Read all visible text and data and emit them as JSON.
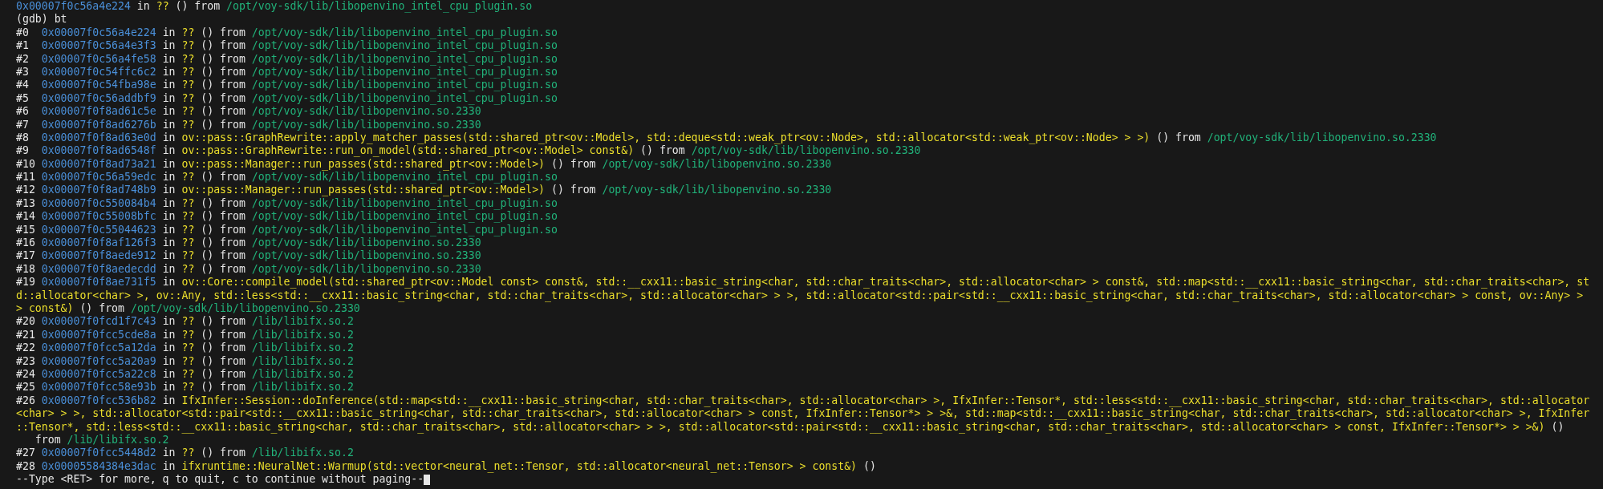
{
  "terminal": {
    "lines": [
      {
        "spans": [
          {
            "kind": "addr",
            "text": "0x00007f0c56a4e224"
          },
          {
            "kind": "text",
            "text": " in "
          },
          {
            "kind": "func",
            "text": "??"
          },
          {
            "kind": "text",
            "text": " () from "
          },
          {
            "kind": "path",
            "text": "/opt/voy-sdk/lib/libopenvino_intel_cpu_plugin.so"
          }
        ]
      },
      {
        "spans": [
          {
            "kind": "text",
            "text": "(gdb) bt"
          }
        ]
      },
      {
        "spans": [
          {
            "kind": "text",
            "text": "#0  "
          },
          {
            "kind": "addr",
            "text": "0x00007f0c56a4e224"
          },
          {
            "kind": "text",
            "text": " in "
          },
          {
            "kind": "func",
            "text": "??"
          },
          {
            "kind": "text",
            "text": " () from "
          },
          {
            "kind": "path",
            "text": "/opt/voy-sdk/lib/libopenvino_intel_cpu_plugin.so"
          }
        ]
      },
      {
        "spans": [
          {
            "kind": "text",
            "text": "#1  "
          },
          {
            "kind": "addr",
            "text": "0x00007f0c56a4e3f3"
          },
          {
            "kind": "text",
            "text": " in "
          },
          {
            "kind": "func",
            "text": "??"
          },
          {
            "kind": "text",
            "text": " () from "
          },
          {
            "kind": "path",
            "text": "/opt/voy-sdk/lib/libopenvino_intel_cpu_plugin.so"
          }
        ]
      },
      {
        "spans": [
          {
            "kind": "text",
            "text": "#2  "
          },
          {
            "kind": "addr",
            "text": "0x00007f0c56a4fe58"
          },
          {
            "kind": "text",
            "text": " in "
          },
          {
            "kind": "func",
            "text": "??"
          },
          {
            "kind": "text",
            "text": " () from "
          },
          {
            "kind": "path",
            "text": "/opt/voy-sdk/lib/libopenvino_intel_cpu_plugin.so"
          }
        ]
      },
      {
        "spans": [
          {
            "kind": "text",
            "text": "#3  "
          },
          {
            "kind": "addr",
            "text": "0x00007f0c54ffc6c2"
          },
          {
            "kind": "text",
            "text": " in "
          },
          {
            "kind": "func",
            "text": "??"
          },
          {
            "kind": "text",
            "text": " () from "
          },
          {
            "kind": "path",
            "text": "/opt/voy-sdk/lib/libopenvino_intel_cpu_plugin.so"
          }
        ]
      },
      {
        "spans": [
          {
            "kind": "text",
            "text": "#4  "
          },
          {
            "kind": "addr",
            "text": "0x00007f0c54fba98e"
          },
          {
            "kind": "text",
            "text": " in "
          },
          {
            "kind": "func",
            "text": "??"
          },
          {
            "kind": "text",
            "text": " () from "
          },
          {
            "kind": "path",
            "text": "/opt/voy-sdk/lib/libopenvino_intel_cpu_plugin.so"
          }
        ]
      },
      {
        "spans": [
          {
            "kind": "text",
            "text": "#5  "
          },
          {
            "kind": "addr",
            "text": "0x00007f0c56addbf9"
          },
          {
            "kind": "text",
            "text": " in "
          },
          {
            "kind": "func",
            "text": "??"
          },
          {
            "kind": "text",
            "text": " () from "
          },
          {
            "kind": "path",
            "text": "/opt/voy-sdk/lib/libopenvino_intel_cpu_plugin.so"
          }
        ]
      },
      {
        "spans": [
          {
            "kind": "text",
            "text": "#6  "
          },
          {
            "kind": "addr",
            "text": "0x00007f0f8ad61c5e"
          },
          {
            "kind": "text",
            "text": " in "
          },
          {
            "kind": "func",
            "text": "??"
          },
          {
            "kind": "text",
            "text": " () from "
          },
          {
            "kind": "path",
            "text": "/opt/voy-sdk/lib/libopenvino.so.2330"
          }
        ]
      },
      {
        "spans": [
          {
            "kind": "text",
            "text": "#7  "
          },
          {
            "kind": "addr",
            "text": "0x00007f0f8ad6276b"
          },
          {
            "kind": "text",
            "text": " in "
          },
          {
            "kind": "func",
            "text": "??"
          },
          {
            "kind": "text",
            "text": " () from "
          },
          {
            "kind": "path",
            "text": "/opt/voy-sdk/lib/libopenvino.so.2330"
          }
        ]
      },
      {
        "spans": [
          {
            "kind": "text",
            "text": "#8  "
          },
          {
            "kind": "addr",
            "text": "0x00007f0f8ad63e0d"
          },
          {
            "kind": "text",
            "text": " in "
          },
          {
            "kind": "func",
            "text": "ov::pass::GraphRewrite::apply_matcher_passes(std::shared_ptr<ov::Model>, std::deque<std::weak_ptr<ov::Node>, std::allocator<std::weak_ptr<ov::Node> > >)"
          },
          {
            "kind": "text",
            "text": " () from "
          },
          {
            "kind": "path",
            "text": "/opt/voy-sdk/lib/libopenvino.so.2330"
          }
        ]
      },
      {
        "spans": [
          {
            "kind": "text",
            "text": "#9  "
          },
          {
            "kind": "addr",
            "text": "0x00007f0f8ad6548f"
          },
          {
            "kind": "text",
            "text": " in "
          },
          {
            "kind": "func",
            "text": "ov::pass::GraphRewrite::run_on_model(std::shared_ptr<ov::Model> const&)"
          },
          {
            "kind": "text",
            "text": " () from "
          },
          {
            "kind": "path",
            "text": "/opt/voy-sdk/lib/libopenvino.so.2330"
          }
        ]
      },
      {
        "spans": [
          {
            "kind": "text",
            "text": "#10 "
          },
          {
            "kind": "addr",
            "text": "0x00007f0f8ad73a21"
          },
          {
            "kind": "text",
            "text": " in "
          },
          {
            "kind": "func",
            "text": "ov::pass::Manager::run_passes(std::shared_ptr<ov::Model>)"
          },
          {
            "kind": "text",
            "text": " () from "
          },
          {
            "kind": "path",
            "text": "/opt/voy-sdk/lib/libopenvino.so.2330"
          }
        ]
      },
      {
        "spans": [
          {
            "kind": "text",
            "text": "#11 "
          },
          {
            "kind": "addr",
            "text": "0x00007f0c56a59edc"
          },
          {
            "kind": "text",
            "text": " in "
          },
          {
            "kind": "func",
            "text": "??"
          },
          {
            "kind": "text",
            "text": " () from "
          },
          {
            "kind": "path",
            "text": "/opt/voy-sdk/lib/libopenvino_intel_cpu_plugin.so"
          }
        ]
      },
      {
        "spans": [
          {
            "kind": "text",
            "text": "#12 "
          },
          {
            "kind": "addr",
            "text": "0x00007f0f8ad748b9"
          },
          {
            "kind": "text",
            "text": " in "
          },
          {
            "kind": "func",
            "text": "ov::pass::Manager::run_passes(std::shared_ptr<ov::Model>)"
          },
          {
            "kind": "text",
            "text": " () from "
          },
          {
            "kind": "path",
            "text": "/opt/voy-sdk/lib/libopenvino.so.2330"
          }
        ]
      },
      {
        "spans": [
          {
            "kind": "text",
            "text": "#13 "
          },
          {
            "kind": "addr",
            "text": "0x00007f0c550084b4"
          },
          {
            "kind": "text",
            "text": " in "
          },
          {
            "kind": "func",
            "text": "??"
          },
          {
            "kind": "text",
            "text": " () from "
          },
          {
            "kind": "path",
            "text": "/opt/voy-sdk/lib/libopenvino_intel_cpu_plugin.so"
          }
        ]
      },
      {
        "spans": [
          {
            "kind": "text",
            "text": "#14 "
          },
          {
            "kind": "addr",
            "text": "0x00007f0c55008bfc"
          },
          {
            "kind": "text",
            "text": " in "
          },
          {
            "kind": "func",
            "text": "??"
          },
          {
            "kind": "text",
            "text": " () from "
          },
          {
            "kind": "path",
            "text": "/opt/voy-sdk/lib/libopenvino_intel_cpu_plugin.so"
          }
        ]
      },
      {
        "spans": [
          {
            "kind": "text",
            "text": "#15 "
          },
          {
            "kind": "addr",
            "text": "0x00007f0c55044623"
          },
          {
            "kind": "text",
            "text": " in "
          },
          {
            "kind": "func",
            "text": "??"
          },
          {
            "kind": "text",
            "text": " () from "
          },
          {
            "kind": "path",
            "text": "/opt/voy-sdk/lib/libopenvino_intel_cpu_plugin.so"
          }
        ]
      },
      {
        "spans": [
          {
            "kind": "text",
            "text": "#16 "
          },
          {
            "kind": "addr",
            "text": "0x00007f0f8af126f3"
          },
          {
            "kind": "text",
            "text": " in "
          },
          {
            "kind": "func",
            "text": "??"
          },
          {
            "kind": "text",
            "text": " () from "
          },
          {
            "kind": "path",
            "text": "/opt/voy-sdk/lib/libopenvino.so.2330"
          }
        ]
      },
      {
        "spans": [
          {
            "kind": "text",
            "text": "#17 "
          },
          {
            "kind": "addr",
            "text": "0x00007f0f8aede912"
          },
          {
            "kind": "text",
            "text": " in "
          },
          {
            "kind": "func",
            "text": "??"
          },
          {
            "kind": "text",
            "text": " () from "
          },
          {
            "kind": "path",
            "text": "/opt/voy-sdk/lib/libopenvino.so.2330"
          }
        ]
      },
      {
        "spans": [
          {
            "kind": "text",
            "text": "#18 "
          },
          {
            "kind": "addr",
            "text": "0x00007f0f8aedecdd"
          },
          {
            "kind": "text",
            "text": " in "
          },
          {
            "kind": "func",
            "text": "??"
          },
          {
            "kind": "text",
            "text": " () from "
          },
          {
            "kind": "path",
            "text": "/opt/voy-sdk/lib/libopenvino.so.2330"
          }
        ]
      },
      {
        "spans": [
          {
            "kind": "text",
            "text": "#19 "
          },
          {
            "kind": "addr",
            "text": "0x00007f0f8ae731f5"
          },
          {
            "kind": "text",
            "text": " in "
          },
          {
            "kind": "func",
            "text": "ov::Core::compile_model(std::shared_ptr<ov::Model const> const&, std::__cxx11::basic_string<char, std::char_traits<char>, std::allocator<char> > const&, std::map<std::__cxx11::basic_string<char, std::char_traits<char>, st"
          }
        ]
      },
      {
        "spans": [
          {
            "kind": "func",
            "text": "d::allocator<char> >, ov::Any, std::less<std::__cxx11::basic_string<char, std::char_traits<char>, std::allocator<char> > >, std::allocator<std::pair<std::__cxx11::basic_string<char, std::char_traits<char>, std::allocator<char> > const, ov::Any> >"
          }
        ]
      },
      {
        "spans": [
          {
            "kind": "func",
            "text": "> const&)"
          },
          {
            "kind": "text",
            "text": " () from "
          },
          {
            "kind": "path",
            "text": "/opt/voy-sdk/lib/libopenvino.so.2330"
          }
        ]
      },
      {
        "spans": [
          {
            "kind": "text",
            "text": "#20 "
          },
          {
            "kind": "addr",
            "text": "0x00007f0fcd1f7c43"
          },
          {
            "kind": "text",
            "text": " in "
          },
          {
            "kind": "func",
            "text": "??"
          },
          {
            "kind": "text",
            "text": " () from "
          },
          {
            "kind": "path",
            "text": "/lib/libifx.so.2"
          }
        ]
      },
      {
        "spans": [
          {
            "kind": "text",
            "text": "#21 "
          },
          {
            "kind": "addr",
            "text": "0x00007f0fcc5cde8a"
          },
          {
            "kind": "text",
            "text": " in "
          },
          {
            "kind": "func",
            "text": "??"
          },
          {
            "kind": "text",
            "text": " () from "
          },
          {
            "kind": "path",
            "text": "/lib/libifx.so.2"
          }
        ]
      },
      {
        "spans": [
          {
            "kind": "text",
            "text": "#22 "
          },
          {
            "kind": "addr",
            "text": "0x00007f0fcc5a12da"
          },
          {
            "kind": "text",
            "text": " in "
          },
          {
            "kind": "func",
            "text": "??"
          },
          {
            "kind": "text",
            "text": " () from "
          },
          {
            "kind": "path",
            "text": "/lib/libifx.so.2"
          }
        ]
      },
      {
        "spans": [
          {
            "kind": "text",
            "text": "#23 "
          },
          {
            "kind": "addr",
            "text": "0x00007f0fcc5a20a9"
          },
          {
            "kind": "text",
            "text": " in "
          },
          {
            "kind": "func",
            "text": "??"
          },
          {
            "kind": "text",
            "text": " () from "
          },
          {
            "kind": "path",
            "text": "/lib/libifx.so.2"
          }
        ]
      },
      {
        "spans": [
          {
            "kind": "text",
            "text": "#24 "
          },
          {
            "kind": "addr",
            "text": "0x00007f0fcc5a22c8"
          },
          {
            "kind": "text",
            "text": " in "
          },
          {
            "kind": "func",
            "text": "??"
          },
          {
            "kind": "text",
            "text": " () from "
          },
          {
            "kind": "path",
            "text": "/lib/libifx.so.2"
          }
        ]
      },
      {
        "spans": [
          {
            "kind": "text",
            "text": "#25 "
          },
          {
            "kind": "addr",
            "text": "0x00007f0fcc58e93b"
          },
          {
            "kind": "text",
            "text": " in "
          },
          {
            "kind": "func",
            "text": "??"
          },
          {
            "kind": "text",
            "text": " () from "
          },
          {
            "kind": "path",
            "text": "/lib/libifx.so.2"
          }
        ]
      },
      {
        "spans": [
          {
            "kind": "text",
            "text": "#26 "
          },
          {
            "kind": "addr",
            "text": "0x00007f0fcc536b82"
          },
          {
            "kind": "text",
            "text": " in "
          },
          {
            "kind": "func",
            "text": "IfxInfer::Session::doInference(std::map<std::__cxx11::basic_string<char, std::char_traits<char>, std::allocator<char> >, IfxInfer::Tensor*, std::less<std::__cxx11::basic_string<char, std::char_traits<char>, std::allocator"
          }
        ]
      },
      {
        "spans": [
          {
            "kind": "func",
            "text": "<char> > >, std::allocator<std::pair<std::__cxx11::basic_string<char, std::char_traits<char>, std::allocator<char> > const, IfxInfer::Tensor*> > >&, std::map<std::__cxx11::basic_string<char, std::char_traits<char>, std::allocator<char> >, IfxInfer"
          }
        ]
      },
      {
        "spans": [
          {
            "kind": "func",
            "text": "::Tensor*, std::less<std::__cxx11::basic_string<char, std::char_traits<char>, std::allocator<char> > >, std::allocator<std::pair<std::__cxx11::basic_string<char, std::char_traits<char>, std::allocator<char> > const, IfxInfer::Tensor*> > >&)"
          },
          {
            "kind": "text",
            "text": " ()"
          }
        ]
      },
      {
        "spans": [
          {
            "kind": "text",
            "text": "   from "
          },
          {
            "kind": "path",
            "text": "/lib/libifx.so.2"
          }
        ]
      },
      {
        "spans": [
          {
            "kind": "text",
            "text": "#27 "
          },
          {
            "kind": "addr",
            "text": "0x00007f0fcc5448d2"
          },
          {
            "kind": "text",
            "text": " in "
          },
          {
            "kind": "func",
            "text": "??"
          },
          {
            "kind": "text",
            "text": " () from "
          },
          {
            "kind": "path",
            "text": "/lib/libifx.so.2"
          }
        ]
      },
      {
        "spans": [
          {
            "kind": "text",
            "text": "#28 "
          },
          {
            "kind": "addr",
            "text": "0x00005584384e3dac"
          },
          {
            "kind": "text",
            "text": " in "
          },
          {
            "kind": "func",
            "text": "ifxruntime::NeuralNet::Warmup(std::vector<neural_net::Tensor, std::allocator<neural_net::Tensor> > const&)"
          },
          {
            "kind": "text",
            "text": " ()"
          }
        ]
      },
      {
        "spans": [
          {
            "kind": "text",
            "text": "--Type <RET> for more, q to quit, c to continue without paging--"
          }
        ],
        "cursor": true
      }
    ]
  }
}
